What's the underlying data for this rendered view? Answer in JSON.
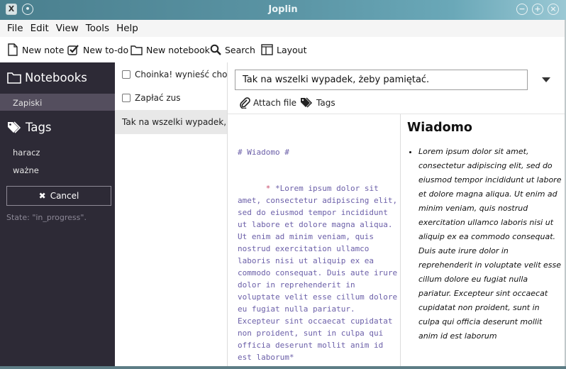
{
  "window": {
    "title": "Joplin"
  },
  "menu": [
    "File",
    "Edit",
    "View",
    "Tools",
    "Help"
  ],
  "toolbar": {
    "new_note": "New note",
    "new_todo": "New to-do",
    "new_notebook": "New notebook",
    "search": "Search",
    "layout": "Layout"
  },
  "sidebar": {
    "notebooks_header": "Notebooks",
    "notebooks": [
      "Zapiski"
    ],
    "tags_header": "Tags",
    "tags": [
      "haracz",
      "ważne"
    ],
    "cancel_label": "Cancel",
    "state_text": "State: \"in_progress\"."
  },
  "notes": [
    {
      "title": "Choinka! wynieść choinkę",
      "is_todo": true,
      "selected": false
    },
    {
      "title": "Zapłać zus",
      "is_todo": true,
      "selected": false
    },
    {
      "title": "Tak na wszelki wypadek, żeby pamiętać.",
      "is_todo": false,
      "selected": true
    }
  ],
  "editor": {
    "title_value": "Tak na wszelki wypadek, żeby pamiętać.",
    "attach_label": "Attach file",
    "tags_label": "Tags",
    "markdown_heading": "# Wiadomo #",
    "markdown_bullet": "*",
    "markdown_body": "*Lorem ipsum dolor sit amet, consectetur adipiscing elit, sed do eiusmod tempor incididunt ut labore et dolore magna aliqua. Ut enim ad minim veniam, quis nostrud exercitation ullamco laboris nisi ut aliquip ex ea commodo consequat. Duis aute irure dolor in reprehenderit in voluptate velit esse cillum dolore eu fugiat nulla pariatur. Excepteur sint occaecat cupidatat non proident, sunt in culpa qui officia deserunt mollit anim id est laborum*",
    "preview_heading": "Wiadomo",
    "preview_item": "Lorem ipsum dolor sit amet, consectetur adipiscing elit, sed do eiusmod tempor incididunt ut labore et dolore magna aliqua. Ut enim ad minim veniam, quis nostrud exercitation ullamco laboris nisi ut aliquip ex ea commodo consequat. Duis aute irure dolor in reprehenderit in voluptate velit esse cillum dolore eu fugiat nulla pariatur. Excepteur sint occaecat cupidatat non proident, sunt in culpa qui officia deserunt mollit anim id est laborum"
  },
  "colors": {
    "sidebar_bg": "#2d2a36",
    "sidebar_selected": "#544e5e",
    "markdown_text": "#6b5fa8",
    "markdown_marker": "#c84a6a"
  }
}
